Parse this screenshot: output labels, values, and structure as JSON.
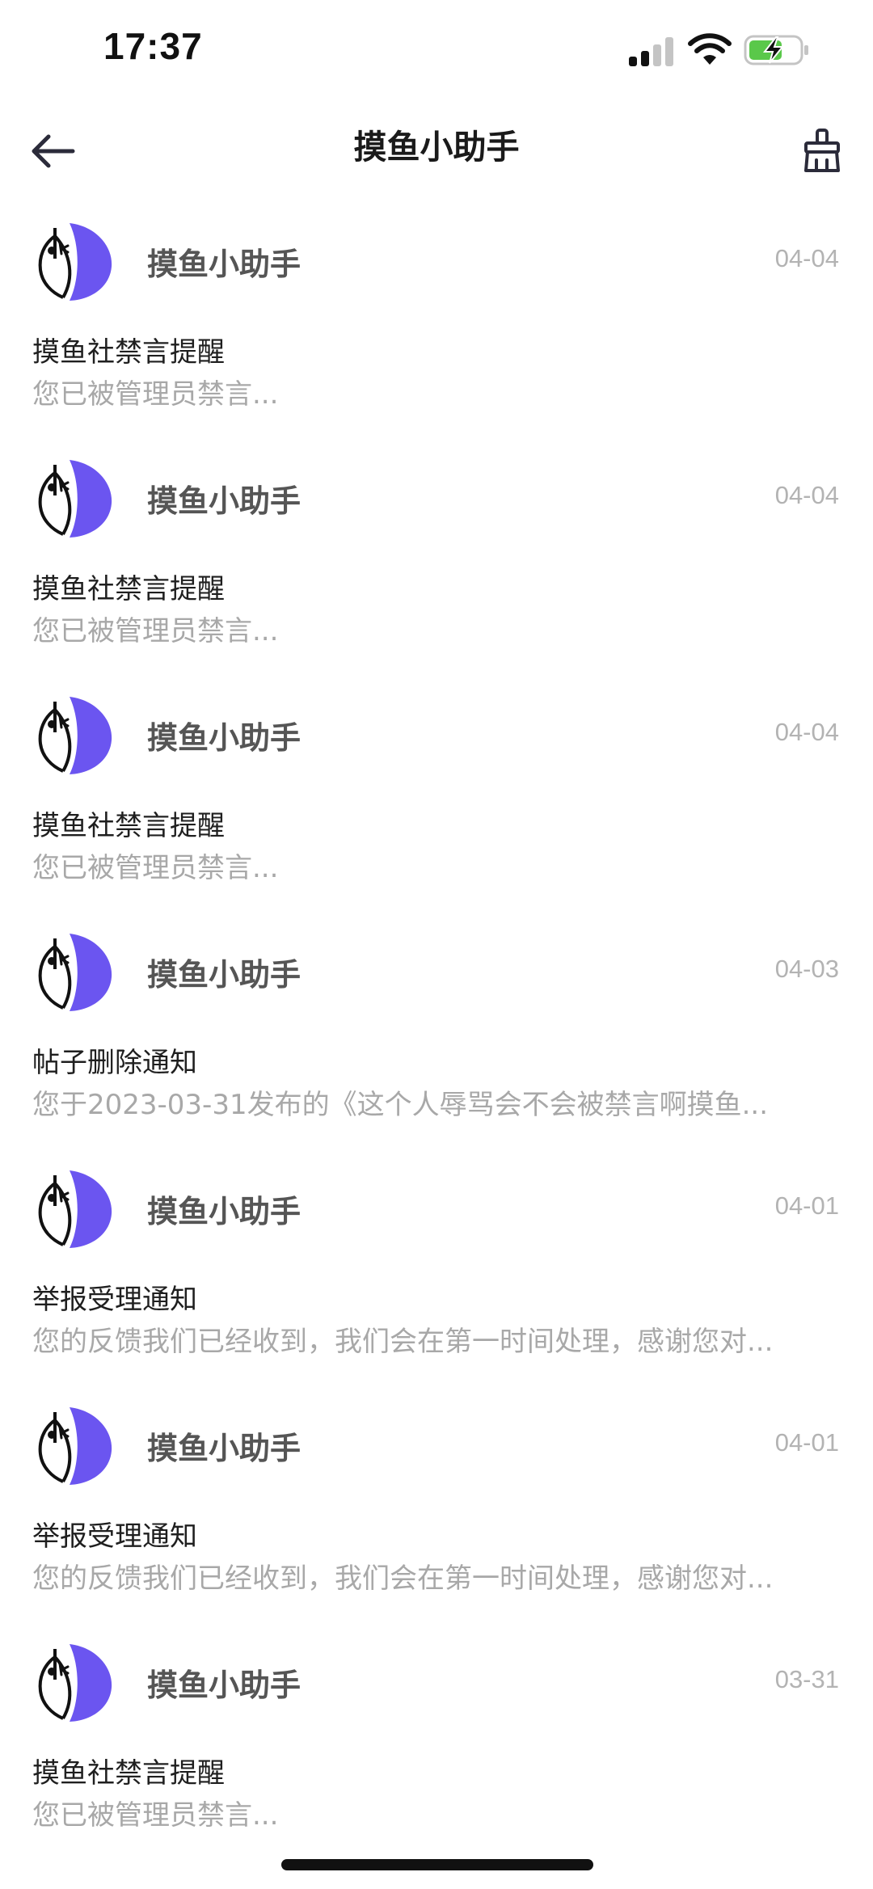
{
  "status_bar": {
    "time": "17:37",
    "signal_icon": "cellular-signal-icon",
    "wifi_icon": "wifi-icon",
    "battery_icon": "battery-charging-icon",
    "battery_color": "#5ac84a"
  },
  "nav": {
    "title": "摸鱼小助手",
    "back_icon": "arrow-left-icon",
    "clear_icon": "broom-icon"
  },
  "colors": {
    "avatar_accent": "#6b55f0",
    "title_text": "#1a1a1a",
    "muted_text": "#a8a8a8"
  },
  "messages": [
    {
      "sender": "摸鱼小助手",
      "date": "04-04",
      "title": "摸鱼社禁言提醒",
      "preview": "您已被管理员禁言..."
    },
    {
      "sender": "摸鱼小助手",
      "date": "04-04",
      "title": "摸鱼社禁言提醒",
      "preview": "您已被管理员禁言..."
    },
    {
      "sender": "摸鱼小助手",
      "date": "04-04",
      "title": "摸鱼社禁言提醒",
      "preview": "您已被管理员禁言..."
    },
    {
      "sender": "摸鱼小助手",
      "date": "04-03",
      "title": "帖子删除通知",
      "preview": "您于2023-03-31发布的《这个人辱骂会不会被禁言啊摸鱼..."
    },
    {
      "sender": "摸鱼小助手",
      "date": "04-01",
      "title": "举报受理通知",
      "preview": "您的反馈我们已经收到，我们会在第一时间处理，感谢您对..."
    },
    {
      "sender": "摸鱼小助手",
      "date": "04-01",
      "title": "举报受理通知",
      "preview": "您的反馈我们已经收到，我们会在第一时间处理，感谢您对..."
    },
    {
      "sender": "摸鱼小助手",
      "date": "03-31",
      "title": "摸鱼社禁言提醒",
      "preview": "您已被管理员禁言..."
    }
  ]
}
